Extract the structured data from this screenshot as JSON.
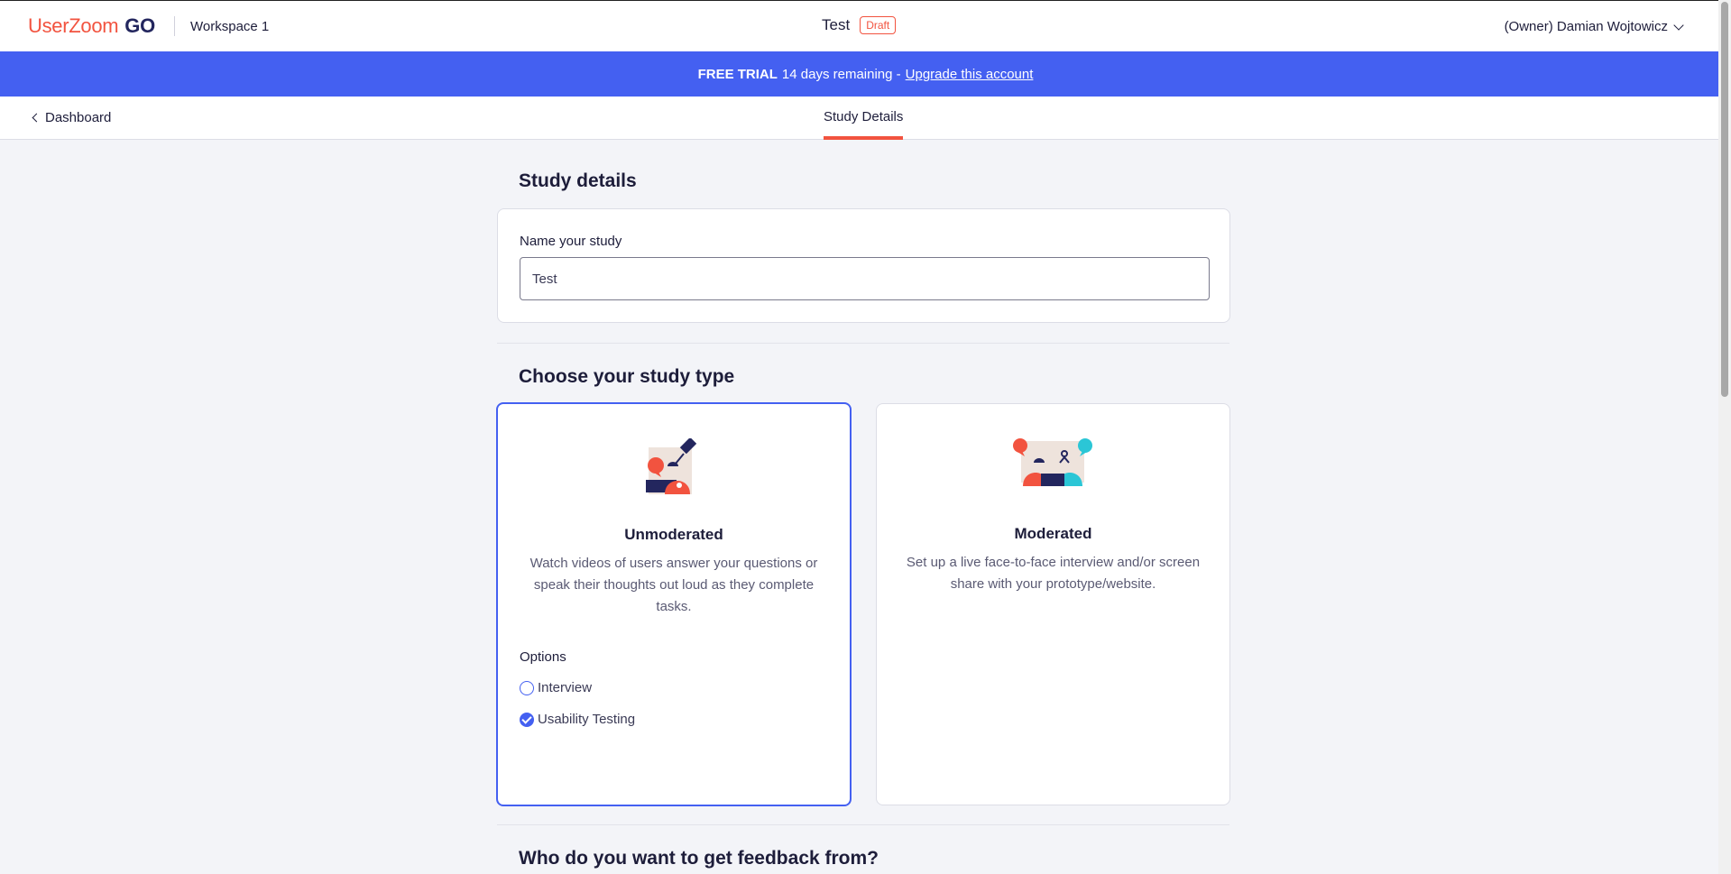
{
  "header": {
    "logo_text": "UserZoom",
    "logo_suffix": "GO",
    "workspace": "Workspace 1",
    "study_title": "Test",
    "status_badge": "Draft",
    "account": "(Owner) Damian Wojtowicz"
  },
  "banner": {
    "label": "FREE TRIAL",
    "remaining": "14 days remaining -",
    "link": "Upgrade this account"
  },
  "subnav": {
    "back_label": "Dashboard",
    "active_tab": "Study Details"
  },
  "study_details": {
    "heading": "Study details",
    "name_label": "Name your study",
    "name_value": "Test"
  },
  "study_type": {
    "heading": "Choose your study type",
    "unmoderated": {
      "title": "Unmoderated",
      "description": "Watch videos of users answer your questions or speak their thoughts out loud as they complete tasks.",
      "options_label": "Options",
      "options": [
        {
          "label": "Interview",
          "checked": false
        },
        {
          "label": "Usability Testing",
          "checked": true
        }
      ]
    },
    "moderated": {
      "title": "Moderated",
      "description": "Set up a live face-to-face interview and/or screen share with your prototype/website."
    }
  },
  "audience": {
    "heading": "Who do you want to get feedback from?"
  },
  "colors": {
    "brand_red": "#f2533f",
    "brand_blue": "#4460f1",
    "navy": "#23265e"
  }
}
